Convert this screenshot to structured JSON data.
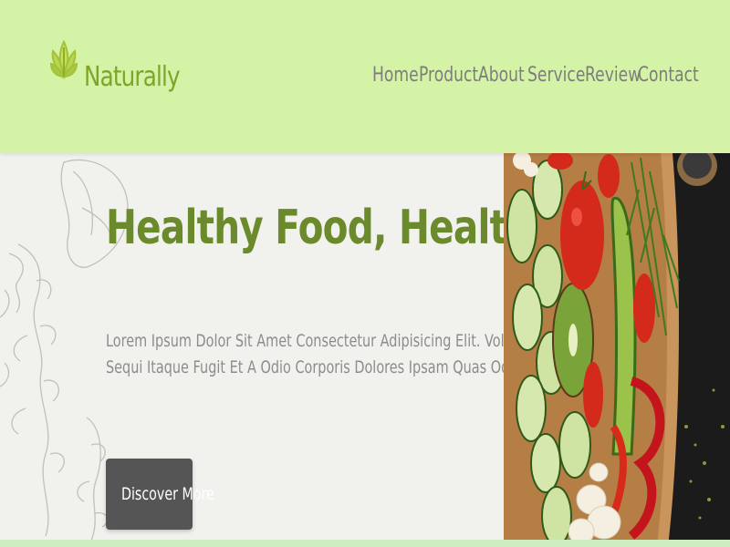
{
  "brand": {
    "name": "Naturally",
    "logo_icon": "leaf-icon"
  },
  "nav": {
    "items": [
      {
        "id": "home",
        "label": "Home"
      },
      {
        "id": "product",
        "label": "Product"
      },
      {
        "id": "about",
        "label": "About"
      },
      {
        "id": "service",
        "label": "Service"
      },
      {
        "id": "review",
        "label": "Review"
      },
      {
        "id": "contact",
        "label": "Contact"
      }
    ]
  },
  "hero": {
    "title": "Healthy Food, Healthy Life.",
    "description_lines": [
      "Lorem Ipsum Dolor Sit Amet Consectetur Adipisicing Elit. Voluptates",
      "Sequi Itaque Fugit Et A Odio Corporis Dolores Ipsam Quas Odit."
    ],
    "cta_label": "Discover More"
  },
  "colors": {
    "header_bg": "#d5f3a6",
    "brand_green": "#7fa427",
    "title_green": "#6b8a2b",
    "nav_text": "#7d7d7d",
    "button_bg": "#555555"
  }
}
